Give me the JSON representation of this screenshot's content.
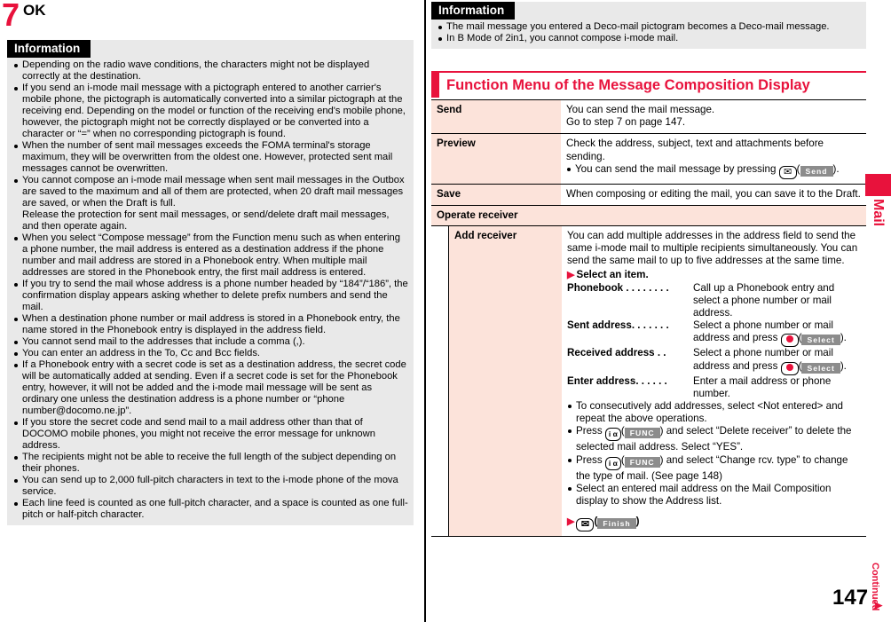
{
  "step": {
    "number": "7",
    "label": "OK"
  },
  "left_information": {
    "title": "Information",
    "items": [
      "Depending on the radio wave conditions, the characters might not be displayed correctly at the destination.",
      "If you send an i-mode mail message with a pictograph entered to another carrier's mobile phone, the pictograph is automatically converted into a similar pictograph at the receiving end. Depending on the model or function of the receiving end's mobile phone, however, the pictograph might not be correctly displayed or be converted into a character or “=” when no corresponding pictograph is found.",
      "When the number of sent mail messages exceeds the FOMA terminal's storage maximum, they will be overwritten from the oldest one. However, protected sent mail messages cannot be overwritten.",
      "You cannot compose an i-mode mail message when sent mail messages in the Outbox are saved to the maximum and all of them are protected, when 20 draft mail messages are saved, or when the Draft is full.",
      "Release the protection for sent mail messages, or send/delete draft mail messages, and then operate again.",
      "When you select “Compose message” from the Function menu such as when entering a phone number, the mail address is entered as a destination address if the phone number and mail address are stored in a Phonebook entry. When multiple mail addresses are stored in the Phonebook entry, the first mail address is entered.",
      "If you try to send the mail whose address is a phone number headed by “184”/“186”, the confirmation display appears asking whether to delete prefix numbers and send the mail.",
      "When a destination phone number or mail address is stored in a Phonebook entry, the name stored in the Phonebook entry is displayed in the address field.",
      "You cannot send mail to the addresses that include a comma (,).",
      "You can enter an address in the To, Cc and Bcc fields.",
      "If a Phonebook entry with a secret code is set as a destination address, the secret code will be automatically added at sending. Even if a secret code is set for the Phonebook entry, however, it will not be added and the i-mode mail message will be sent as ordinary one unless the destination address is a phone number or “phone number@docomo.ne.jp”.",
      "If you store the secret code and send mail to a mail address other than that of DOCOMO mobile phones, you might not receive the error message for unknown address.",
      "The recipients might not be able to receive the full length of the subject depending on their phones.",
      "You can send up to 2,000 full-pitch characters in text to the i-mode phone of the mova service.",
      "Each line feed is counted as one full-pitch character, and a space is counted as one full-pitch or half-pitch character."
    ]
  },
  "right_information": {
    "title": "Information",
    "items": [
      "The mail message you entered a Deco-mail pictogram becomes a Deco-mail message.",
      "In B Mode of 2in1, you cannot compose i-mode mail."
    ]
  },
  "section": {
    "title": "Function Menu of the Message Composition Display"
  },
  "function_menu": {
    "rows": [
      {
        "label": "Send",
        "lines": [
          "You can send the mail message.",
          "Go to step 7 on page 147."
        ]
      },
      {
        "label": "Preview",
        "lines": [
          "Check the address, subject, text and attachments before sending."
        ],
        "bullets": [
          {
            "pre": "You can send the mail message by pressing ",
            "key": "mail-key",
            "soft": "Send",
            "post": ")."
          }
        ]
      },
      {
        "label": "Save",
        "lines": [
          "When composing or editing the mail, you can save it to the Draft."
        ]
      }
    ],
    "group": {
      "label": "Operate receiver"
    },
    "add_receiver": {
      "label": "Add receiver",
      "intro": [
        "You can add multiple addresses in the address field to send the same i-mode mail to multiple recipients simultaneously. You can send the same mail to up to five addresses at the same time."
      ],
      "select_item": "Select an item.",
      "options": [
        {
          "term": "Phonebook",
          "leader": " . . . . . . . .",
          "def_pre": "Call up a Phonebook entry and select a phone number or mail address.",
          "key": "",
          "soft": "",
          "def_post": ""
        },
        {
          "term": "Sent address",
          "leader": ". . . . . . .",
          "def_pre": "Select a phone number or mail address and press ",
          "key": "center-key",
          "soft": "Select",
          "def_post": ")."
        },
        {
          "term": "Received address",
          "leader": " . .",
          "def_pre": "Select a phone number or mail address and press ",
          "key": "center-key",
          "soft": "Select",
          "def_post": ")."
        },
        {
          "term": "Enter address",
          "leader": ". . . . . .",
          "def_pre": "Enter a mail address or phone number.",
          "key": "",
          "soft": "",
          "def_post": ""
        }
      ],
      "bullets": [
        {
          "pre": "To consecutively add addresses, select <Not entered> and repeat the above operations.",
          "key": "",
          "soft": "",
          "post": ""
        },
        {
          "pre": "Press ",
          "key": "func-key",
          "soft": "FUNC",
          "post": ") and select “Delete receiver” to delete the selected mail address. Select “YES”."
        },
        {
          "pre": "Press ",
          "key": "func-key",
          "soft": "FUNC",
          "post": ") and select “Change rcv. type” to change the type of mail. (See page 148)"
        },
        {
          "pre": "Select an entered mail address on the Mail Composition display to show the Address list.",
          "key": "",
          "soft": "",
          "post": ""
        }
      ],
      "finish": {
        "key": "mail-key",
        "soft": "Finish",
        "post": ")"
      }
    }
  },
  "edge_tab": {
    "label": "Mail"
  },
  "footer": {
    "page_number": "147",
    "continued": "Continued"
  },
  "colors": {
    "accent_red": "#e8123c",
    "label_pink": "#fce3da",
    "info_gray": "#e9e9e9"
  }
}
